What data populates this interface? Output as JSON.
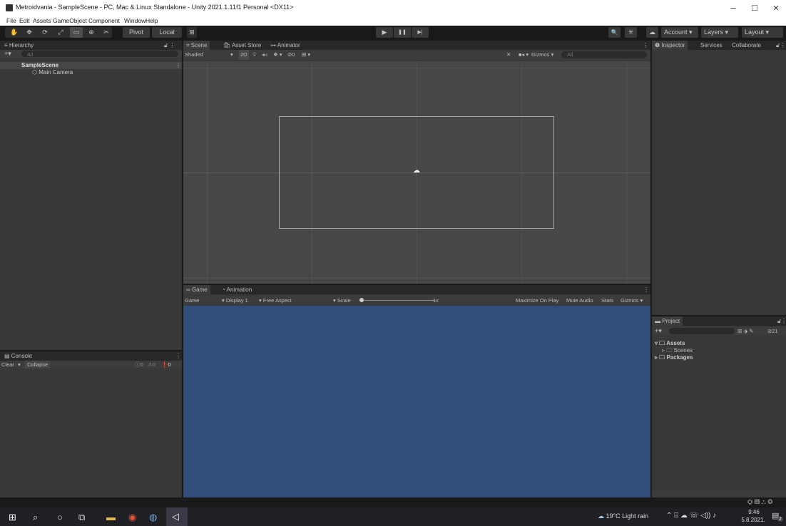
{
  "window": {
    "title": "Metroidvania - SampleScene - PC, Mac & Linux Standalone - Unity 2021.1.11f1 Personal <DX11>",
    "minimize": "–",
    "maximize": "□",
    "close": "✕"
  },
  "menu": [
    "File",
    "Edit",
    "Assets",
    "GameObject",
    "Component",
    "Window",
    "Help"
  ],
  "toolbar": {
    "tools": [
      "✋",
      "✥",
      "⟳",
      "⤢",
      "▭",
      "⊕",
      "✂"
    ],
    "pivot": "Pivot",
    "local": "Local",
    "play": "▶",
    "pause": "❚❚",
    "step": "▶|",
    "search": "🔍",
    "collab": "☁",
    "account": "Account",
    "layers": "Layers",
    "layout": "Layout"
  },
  "hierarchy": {
    "title": "Hierarchy",
    "add": "+▾",
    "search_placeholder": "All",
    "scene": "SampleScene",
    "items": [
      "Main Camera"
    ]
  },
  "scene": {
    "tabs": [
      "Scene",
      "Asset Store",
      "Animator"
    ],
    "shading": "Shaded",
    "mode2d": "2D",
    "hidden_count": "0",
    "gizmos": "Gizmos",
    "search_placeholder": "All"
  },
  "game": {
    "tabs": [
      "Game",
      "Animation"
    ],
    "display_mode": "Game",
    "display": "Display 1",
    "aspect": "Free Aspect",
    "scale_label": "Scale",
    "scale_value": "1x",
    "maximize": "Maximize On Play",
    "mute": "Mute Audio",
    "stats": "Stats",
    "gizmos": "Gizmos",
    "bg_color": "#314d7a"
  },
  "inspector": {
    "tabs": [
      "Inspector",
      "Services",
      "Collaborate"
    ]
  },
  "console": {
    "title": "Console",
    "clear": "Clear",
    "collapse": "Collapse",
    "counts": [
      "0",
      "0",
      "0"
    ]
  },
  "project": {
    "title": "Project",
    "add": "+▾",
    "packages_count": "21",
    "tree": [
      {
        "label": "Assets",
        "indent": 0
      },
      {
        "label": "Scenes",
        "indent": 1
      },
      {
        "label": "Packages",
        "indent": 0
      }
    ]
  },
  "taskbar": {
    "weather": "19°C  Light rain",
    "time": "9:46",
    "date": "5.8.2021.",
    "notif": "2"
  }
}
